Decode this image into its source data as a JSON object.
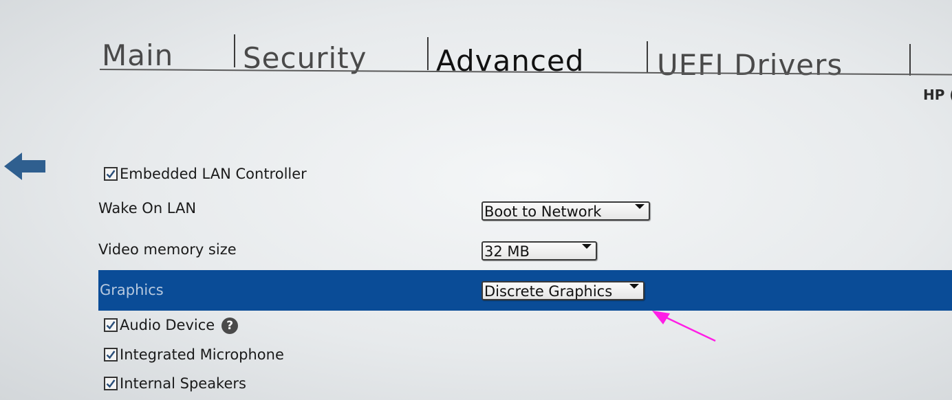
{
  "tabs": [
    {
      "label": "Main",
      "active": false
    },
    {
      "label": "Security",
      "active": false
    },
    {
      "label": "Advanced",
      "active": true
    },
    {
      "label": "UEFI Drivers",
      "active": false
    }
  ],
  "corner_label": "HP (",
  "settings": {
    "embedded_lan": {
      "label": "Embedded LAN Controller",
      "checked": true
    },
    "wake_on_lan": {
      "label": "Wake On LAN",
      "value": "Boot to Network"
    },
    "video_memory": {
      "label": "Video memory size",
      "value": "32 MB"
    },
    "graphics": {
      "label": "Graphics",
      "value": "Discrete Graphics",
      "selected": true
    },
    "audio_device": {
      "label": "Audio Device",
      "checked": true,
      "help_icon": "?"
    },
    "integrated_microphone": {
      "label": "Integrated Microphone",
      "checked": true
    },
    "internal_speakers": {
      "label": "Internal Speakers",
      "checked": true
    }
  },
  "icons": {
    "back": "back-arrow-icon",
    "help": "help-icon",
    "checkmark": "checkmark-icon",
    "dropdown": "dropdown-caret-icon",
    "annotation": "annotation-arrow-icon"
  },
  "colors": {
    "selection_bar": "#0a4c97",
    "back_arrow": "#2f5f8f",
    "annotation_arrow": "#ff1ee6"
  }
}
